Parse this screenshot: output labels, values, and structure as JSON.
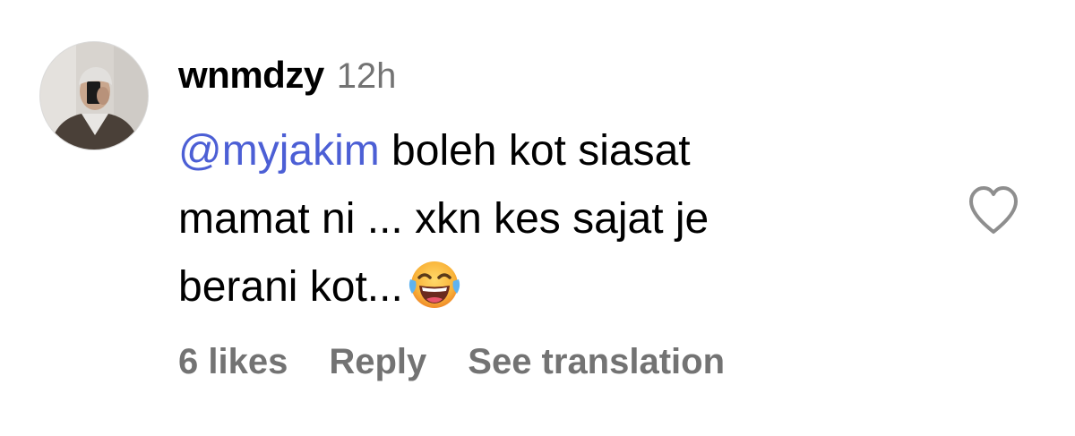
{
  "comment": {
    "username": "wnmdzy",
    "timestamp": "12h",
    "mention": "@myjakim",
    "line1_rest": " boleh kot siasat",
    "line2": "mamat ni ... xkn kes sajat je",
    "line3": "berani kot...",
    "emoji": "face-with-tears-of-joy",
    "likes": "6 likes",
    "reply_label": "Reply",
    "translate_label": "See translation"
  },
  "colors": {
    "mention": "#4c5fd5",
    "secondary_text": "#737373",
    "heart_outline": "#8e8e8e"
  }
}
